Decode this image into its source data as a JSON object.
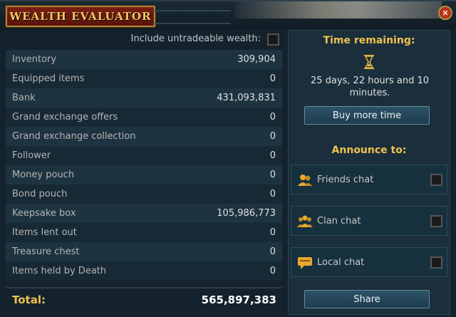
{
  "window": {
    "title": "WEALTH EVALUATOR",
    "close_glyph": "✕"
  },
  "untradeable": {
    "label": "Include untradeable wealth:",
    "checked": false
  },
  "rows": [
    {
      "label": "Inventory",
      "value": "309,904"
    },
    {
      "label": "Equipped items",
      "value": "0"
    },
    {
      "label": "Bank",
      "value": "431,093,831"
    },
    {
      "label": "Grand exchange offers",
      "value": "0"
    },
    {
      "label": "Grand exchange collection",
      "value": "0"
    },
    {
      "label": "Follower",
      "value": "0"
    },
    {
      "label": "Money pouch",
      "value": "0"
    },
    {
      "label": "Bond pouch",
      "value": "0"
    },
    {
      "label": "Keepsake box",
      "value": "105,986,773"
    },
    {
      "label": "Items lent out",
      "value": "0"
    },
    {
      "label": "Treasure chest",
      "value": "0"
    },
    {
      "label": "Items held by Death",
      "value": "0"
    }
  ],
  "total": {
    "label": "Total:",
    "value": "565,897,383"
  },
  "time": {
    "title": "Time remaining:",
    "icon": "hourglass-icon",
    "text": "25 days, 22 hours and 10 minutes."
  },
  "buy_button": "Buy more time",
  "announce": {
    "title": "Announce to:",
    "options": [
      {
        "label": "Friends chat",
        "icon": "friends-chat-icon",
        "checked": false
      },
      {
        "label": "Clan chat",
        "icon": "clan-chat-icon",
        "checked": false
      },
      {
        "label": "Local chat",
        "icon": "local-chat-icon",
        "checked": false
      }
    ]
  },
  "share_button": "Share",
  "colors": {
    "accent_gold": "#f0c050",
    "title_red": "#7a1e14",
    "panel_bg": "#13222c"
  }
}
